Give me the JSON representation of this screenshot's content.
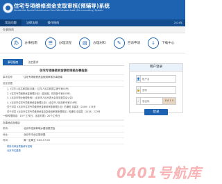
{
  "header": {
    "title": "住宅专项维修资金支取审核(预辅导)系统",
    "subtitle": "Residential Special Maintenance Fund Withdrawal Audit (Pre-counseling) System"
  },
  "nav": {
    "items": [
      "常见问题",
      "法律法规",
      "操作指南"
    ],
    "right_text": "2024年"
  },
  "breadcrumb": "办事指南",
  "shortcuts": [
    {
      "icon": "办",
      "label": "办事指南"
    },
    {
      "icon": "☰",
      "label": "办理流程"
    },
    {
      "icon": "▤",
      "label": "办理材料"
    },
    {
      "icon": "✎",
      "label": "咨询申请"
    },
    {
      "icon": "↓",
      "label": "下载中心"
    }
  ],
  "tabs": [
    "事项指南",
    "法定要求"
  ],
  "doc": {
    "title": "住宅专项维修资金使用审核办事指南",
    "item_label": "事项名称",
    "basis_label": "设定依据",
    "lines": [
      "1.《中华人民共和国民法典》（中华人民共和国主席令第45号）",
      "2.《住宅专项维修资金管理办法》（建设部、财政部令第165号）",
      "3.《北京市物业管理条例》（北京市人民代表大会常务委员会公告）",
      "4.《北京市住宅专项维修资金管理办法》（北京市人民政府令第258号）",
      "关于印发《北京市住宅专项维修资金使用审核管理办法》的通知 京建发〔2009〕474号",
      "关于印发《北京市住宅专项维修资金应急使用审核管理规定》的通知 京建发〔2018〕272号"
    ],
    "time_line": "一般时限规定：15个工作日，法定时限：20个工作日",
    "section_title": "办事地点及电话",
    "dept_label": "机构：",
    "dept_value": "北京市住房和城乡建设委员会",
    "addr_label": "地址：",
    "addr_value": "北京市丰台区丽泽路",
    "hours_label": "时间：",
    "hours_value": "周一至周五 9:00-17:00",
    "more_links": [
      "材料清单及表格填写说明",
      "北京市住建委"
    ]
  },
  "login": {
    "title": "用户登录",
    "username_placeholder": "账户名",
    "password_placeholder": "密码",
    "captcha_placeholder": "验证码",
    "captcha_code": "8 8 1 0",
    "button": "登录"
  },
  "watermark": "0401号航库"
}
